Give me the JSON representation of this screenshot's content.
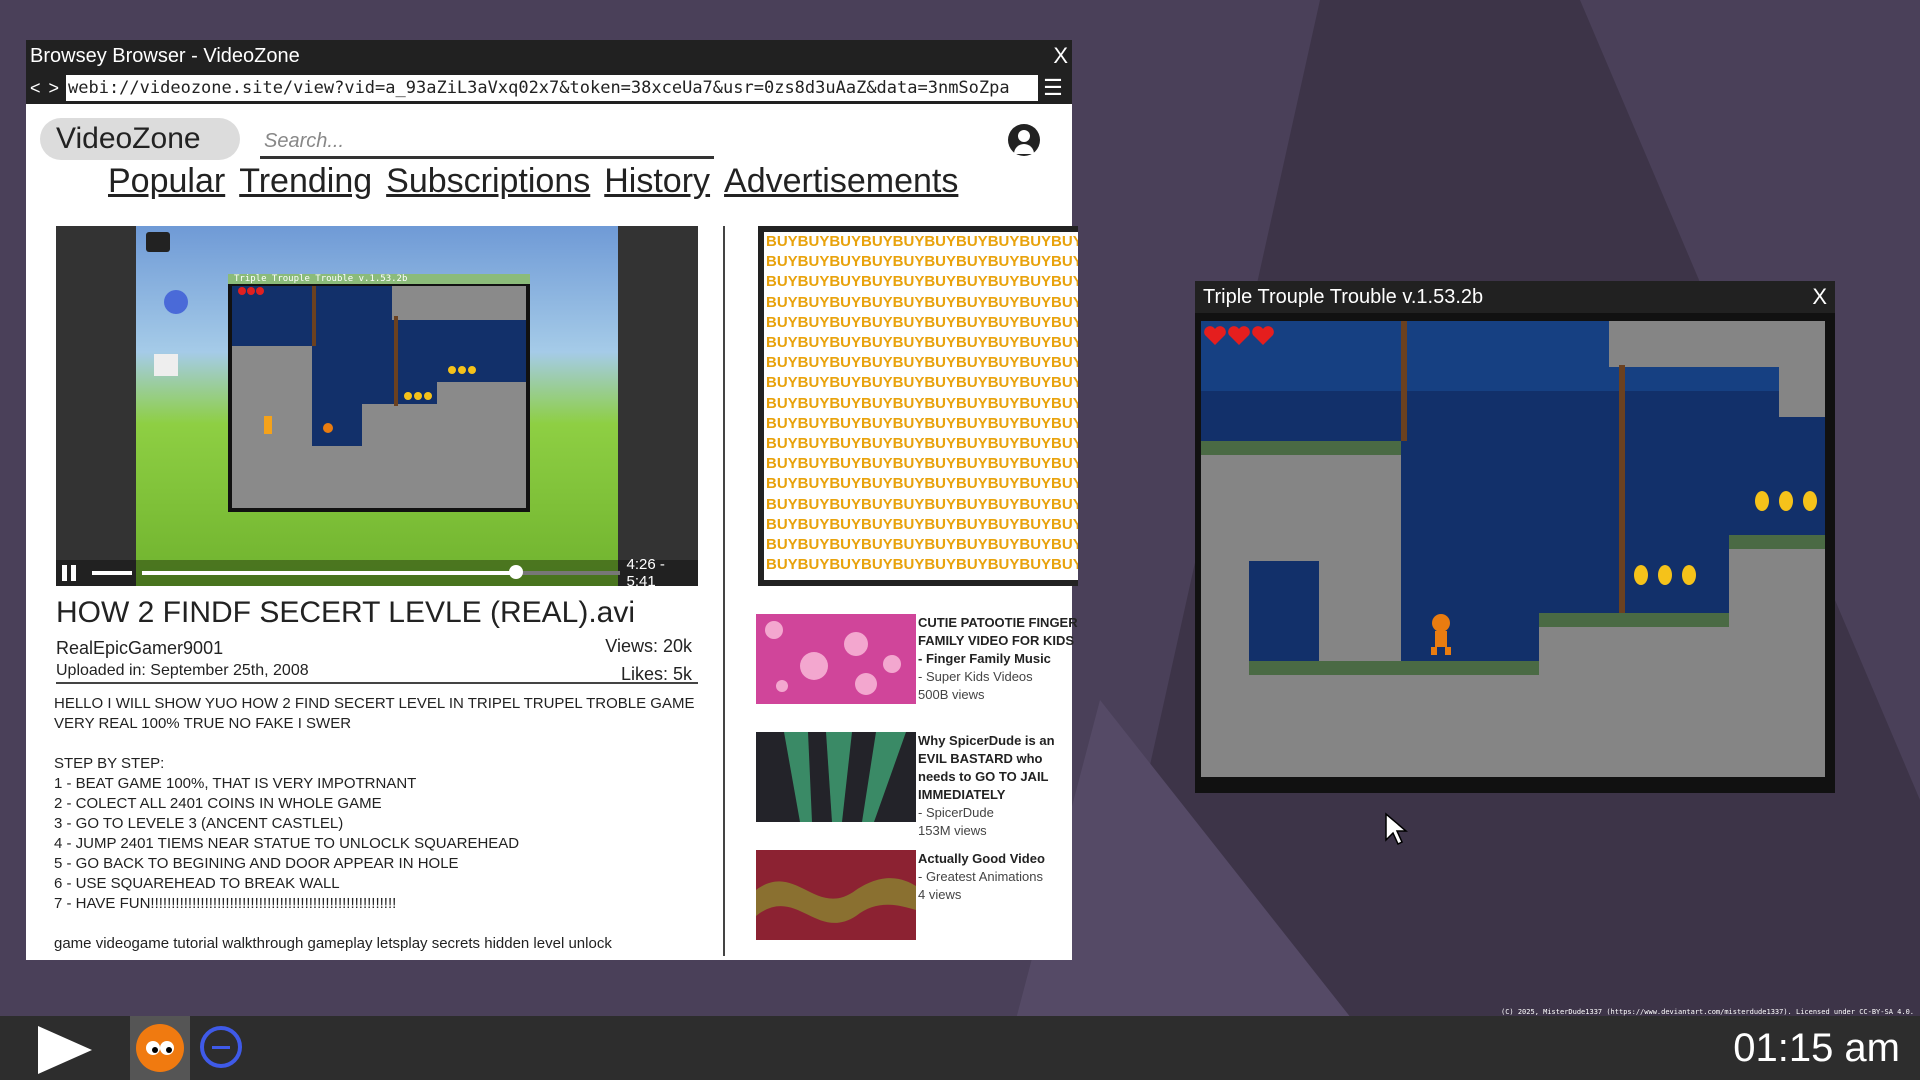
{
  "browser": {
    "title": "Browsey Browser - VideoZone",
    "close": "X",
    "back": "<",
    "forward": ">",
    "url": "webi://videozone.site/view?vid=a_93aZiL3aVxq02x7&token=38xceUa7&usr=0zs8d3uAaZ&data=3nmSoZpa"
  },
  "site": {
    "logo": "VideoZone",
    "search_placeholder": "Search...",
    "nav": [
      "Popular",
      "Trending",
      "Subscriptions",
      "History",
      "Advertisements"
    ]
  },
  "video": {
    "embedded_title": "Triple Trouple Trouble v.1.53.2b",
    "time": "4:26 - 5:41",
    "progress": 0.78,
    "title": "HOW 2 FINDF SECERT LEVLE (REAL).avi",
    "channel": "RealEpicGamer9001",
    "uploaded": "Uploaded in: September 25th, 2008",
    "views": "Views: 20k",
    "likes": "Likes: 5k",
    "description": "HELLO I WILL SHOW YUO HOW 2 FIND SECERT LEVEL IN TRIPEL TRUPEL TROBLE GAME\nVERY REAL 100% TRUE NO FAKE I SWER\n\nSTEP BY STEP:\n1 - BEAT GAME 100%, THAT IS VERY IMPOTRNANT\n2 - COLECT ALL 2401 COINS IN WHOLE GAME\n3 - GO TO LEVELE 3 (ANCENT CASTLEL)\n4 - JUMP 2401 TIEMS NEAR STATUE TO UNLOCLK SQUAREHEAD\n5 - GO BACK TO BEGINING AND DOOR APPEAR IN HOLE\n6 - USE SQUAREHEAD TO BREAK WALL\n7 - HAVE FUN!!!!!!!!!!!!!!!!!!!!!!!!!!!!!!!!!!!!!!!!!!!!!!!!!!!!!!!!!!!\n\ngame videogame tutorial walkthrough gameplay letsplay secrets hidden level unlock"
  },
  "ad": {
    "line": "BUYBUYBUYBUYBUYBUYBUYBUYBUYBUYBUYBUY",
    "rows": 17
  },
  "recommendations": [
    {
      "title": "CUTIE PATOOTIE FINGER FAMILY VIDEO FOR KIDS - Finger Family Music",
      "channel": "- Super Kids Videos",
      "views": "500B views"
    },
    {
      "title": "Why SpicerDude is an EVIL BASTARD who needs to GO TO JAIL IMMEDIATELY",
      "channel": "- SpicerDude",
      "views": "153M views"
    },
    {
      "title": "Actually Good Video",
      "channel": "- Greatest Animations",
      "views": "4 views"
    }
  ],
  "game": {
    "title": "Triple Trouple Trouble v.1.53.2b",
    "close": "X",
    "hearts": 3
  },
  "taskbar": {
    "clock": "01:15 am",
    "credit": "(C) 2025, MisterDude1337 (https://www.deviantart.com/misterdude1337). Licensed under CC-BY-SA 4.0."
  },
  "colors": {
    "desktop": "#4a4059",
    "titlebar": "#212121",
    "ad_text": "#e8a20c",
    "browser_icon": "#3f5ae8",
    "game_icon": "#f07a10"
  }
}
